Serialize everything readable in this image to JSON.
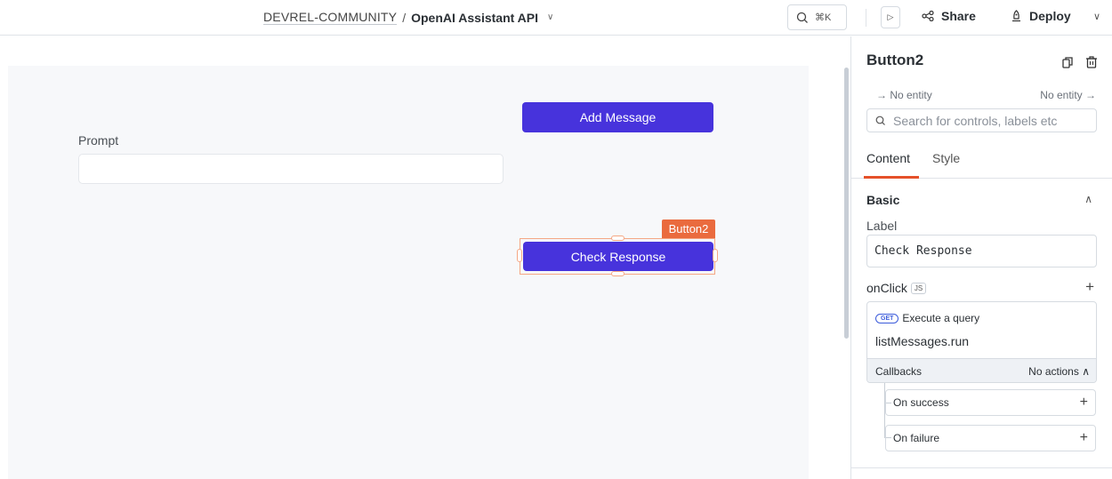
{
  "topbar": {
    "workspace": "DEVREL-COMMUNITY",
    "separator": "/",
    "app_name": "OpenAI Assistant API",
    "app_menu_icon": "chevron-down-icon",
    "search_shortcut": "⌘K",
    "share_label": "Share",
    "deploy_label": "Deploy"
  },
  "canvas": {
    "prompt_label": "Prompt",
    "prompt_value": "",
    "add_message_label": "Add Message",
    "check_response_label": "Check Response",
    "selected_widget_tag": "Button2",
    "button_color": "#4733dc",
    "selection_color": "#ea6b3e"
  },
  "panel": {
    "title": "Button2",
    "entity_left": "→ No entity",
    "entity_right": "No entity →",
    "search_placeholder": "Search for controls, labels etc",
    "tabs": [
      {
        "label": "Content",
        "active": true
      },
      {
        "label": "Style",
        "active": false
      }
    ],
    "section_title": "Basic",
    "label_field": {
      "label": "Label",
      "value": "Check Response"
    },
    "onclick": {
      "label": "onClick",
      "js_badge": "JS",
      "action": {
        "method_badge": "GET",
        "title": "Execute a query",
        "query": "listMessages.run"
      },
      "callbacks_label": "Callbacks",
      "callbacks_status": "No actions",
      "callback_items": [
        {
          "label": "On success"
        },
        {
          "label": "On failure"
        }
      ]
    }
  }
}
